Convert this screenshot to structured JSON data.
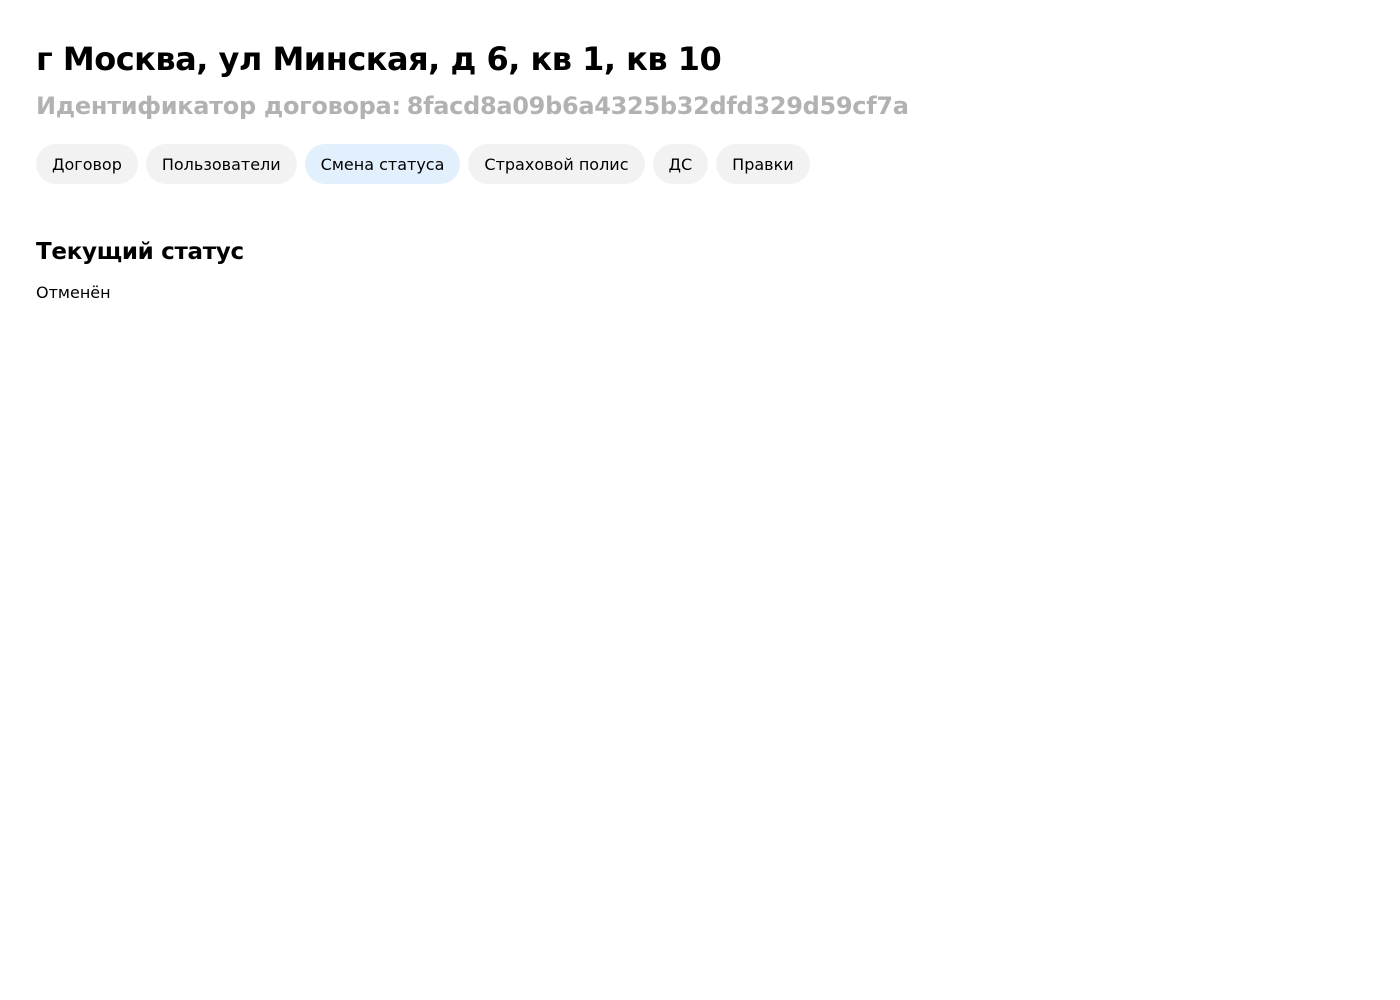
{
  "header": {
    "title": "г Москва, ул Минская, д 6, кв 1, кв 10",
    "contract_id_label": "Идентификатор договора:",
    "contract_id_value": "8facd8a09b6a4325b32dfd329d59cf7a"
  },
  "tabs": [
    {
      "label": "Договор",
      "active": false
    },
    {
      "label": "Пользователи",
      "active": false
    },
    {
      "label": "Смена статуса",
      "active": true
    },
    {
      "label": "Страховой полис",
      "active": false
    },
    {
      "label": "ДС",
      "active": false
    },
    {
      "label": "Правки",
      "active": false
    }
  ],
  "status_section": {
    "title": "Текущий статус",
    "value": "Отменён"
  },
  "colors": {
    "tab_background": "#f2f2f2",
    "tab_active_background": "#e2effd",
    "subtitle_text": "#b2b2b2"
  }
}
